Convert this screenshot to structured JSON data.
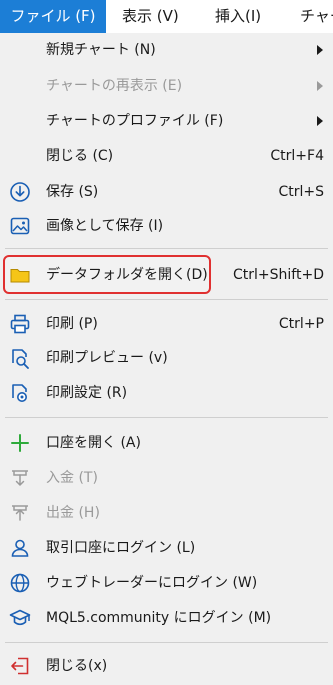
{
  "menubar": {
    "file": "ファイル (F)",
    "view": "表示 (V)",
    "insert": "挿入(I)",
    "chart": "チャー"
  },
  "menu": {
    "new_chart": "新規チャート (N)",
    "reopen_chart": "チャートの再表示 (E)",
    "chart_profiles": "チャートのプロファイル (F)",
    "close": {
      "label": "閉じる (C)",
      "shortcut": "Ctrl+F4"
    },
    "save": {
      "label": "保存 (S)",
      "shortcut": "Ctrl+S"
    },
    "save_as_image": "画像として保存 (I)",
    "open_data_folder": {
      "label": "データフォルダを開く(D)",
      "shortcut": "Ctrl+Shift+D"
    },
    "print": {
      "label": "印刷 (P)",
      "shortcut": "Ctrl+P"
    },
    "print_preview": "印刷プレビュー (v)",
    "print_setup": "印刷設定 (R)",
    "open_account": "口座を開く (A)",
    "deposit": "入金 (T)",
    "withdraw": "出金 (H)",
    "login_trade_account": "取引口座にログイン (L)",
    "login_webtrader": "ウェブトレーダーにログイン (W)",
    "login_mql5": "MQL5.community にログイン (M)",
    "exit": "閉じる(x)"
  },
  "colors": {
    "accent": "#1c7ed6",
    "highlight_border": "#e03030",
    "folder": "#f5c518",
    "icon_blue": "#1a5fb4",
    "add_green": "#2eaa3a",
    "exit_red": "#d03030",
    "disabled": "#9a9a9a"
  },
  "icons": {
    "save": "download-circle-icon",
    "save_as_image": "image-icon",
    "open_data_folder": "folder-icon",
    "print": "printer-icon",
    "print_preview": "print-preview-icon",
    "print_setup": "settings-gear-icon",
    "open_account": "plus-icon",
    "deposit": "deposit-icon",
    "withdraw": "withdraw-icon",
    "login_trade_account": "user-icon",
    "login_webtrader": "globe-icon",
    "login_mql5": "graduation-cap-icon",
    "exit": "exit-arrow-icon"
  }
}
